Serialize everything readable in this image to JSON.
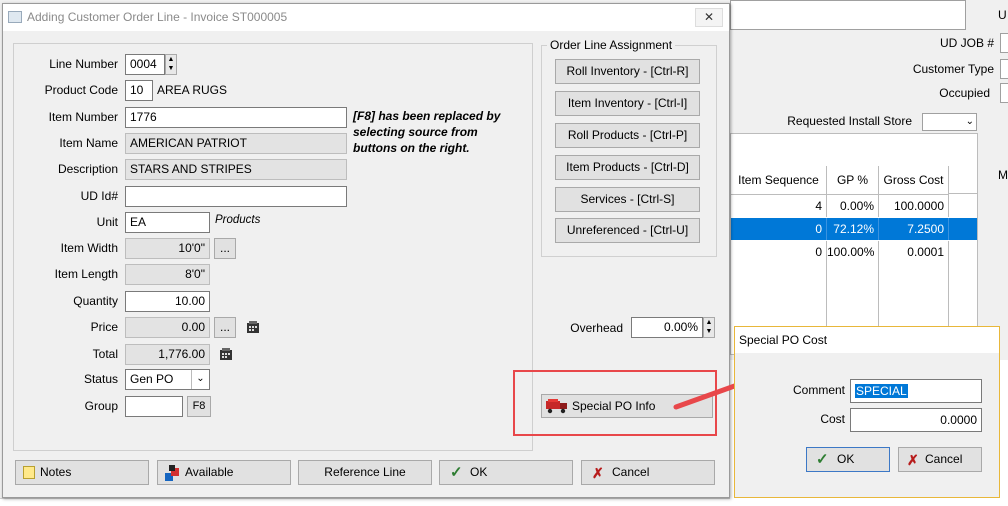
{
  "dialog": {
    "title": "Adding Customer Order Line - Invoice ST000005",
    "close": "✕"
  },
  "form": {
    "line_number": {
      "label": "Line Number",
      "value": "0004"
    },
    "product_code": {
      "label": "Product Code",
      "value": "10",
      "name": "AREA RUGS"
    },
    "item_number": {
      "label": "Item Number",
      "value": "1776"
    },
    "item_name": {
      "label": "Item Name",
      "value": "AMERICAN PATRIOT"
    },
    "description": {
      "label": "Description",
      "value": "STARS AND STRIPES"
    },
    "ud_id": {
      "label": "UD Id#",
      "value": ""
    },
    "unit": {
      "label": "Unit",
      "value": "EA",
      "note": "Products"
    },
    "item_width": {
      "label": "Item Width",
      "value": "10'0\""
    },
    "item_length": {
      "label": "Item Length",
      "value": "8'0\""
    },
    "quantity": {
      "label": "Quantity",
      "value": "10.00"
    },
    "price": {
      "label": "Price",
      "value": "0.00"
    },
    "total": {
      "label": "Total",
      "value": "1,776.00"
    },
    "status": {
      "label": "Status",
      "value": "Gen PO"
    },
    "group": {
      "label": "Group",
      "value": "",
      "button": "F8"
    },
    "ellipsis": "...",
    "f8_note": [
      "[F8] has been replaced by",
      "selecting source from",
      "buttons on the right."
    ]
  },
  "assignment": {
    "title": "Order Line Assignment",
    "buttons": [
      "Roll Inventory - [Ctrl-R]",
      "Item Inventory - [Ctrl-I]",
      "Roll Products - [Ctrl-P]",
      "Item Products - [Ctrl-D]",
      "Services - [Ctrl-S]",
      "Unreferenced - [Ctrl-U]"
    ]
  },
  "overhead": {
    "label": "Overhead",
    "value": "0.00%"
  },
  "special_po": {
    "label": "Special PO Info"
  },
  "bottom_buttons": {
    "notes": "Notes",
    "available": "Available",
    "reference_line": "Reference Line",
    "ok": "OK",
    "cancel": "Cancel"
  },
  "background": {
    "corner_u": "U",
    "ud_job": "UD JOB #",
    "customer_type": "Customer Type",
    "occupied": "Occupied",
    "requested_install_store": "Requested Install Store",
    "right_m": "M",
    "table": {
      "columns": [
        "Item Sequence",
        "GP %",
        "Gross Cost"
      ],
      "rows": [
        [
          "4",
          "0.00%",
          "100.0000"
        ],
        [
          "0",
          "72.12%",
          "7.2500"
        ],
        [
          "0",
          "100.00%",
          "0.0001"
        ]
      ]
    }
  },
  "popup": {
    "title": "Special PO Cost",
    "comment_label": "Comment",
    "comment_value": "SPECIAL",
    "cost_label": "Cost",
    "cost_value": "0.0000",
    "ok": "OK",
    "cancel": "Cancel"
  },
  "colors": {
    "accent": "#0078d7",
    "highlight_box": "#e8474a",
    "popup_border": "#e8b73a"
  }
}
